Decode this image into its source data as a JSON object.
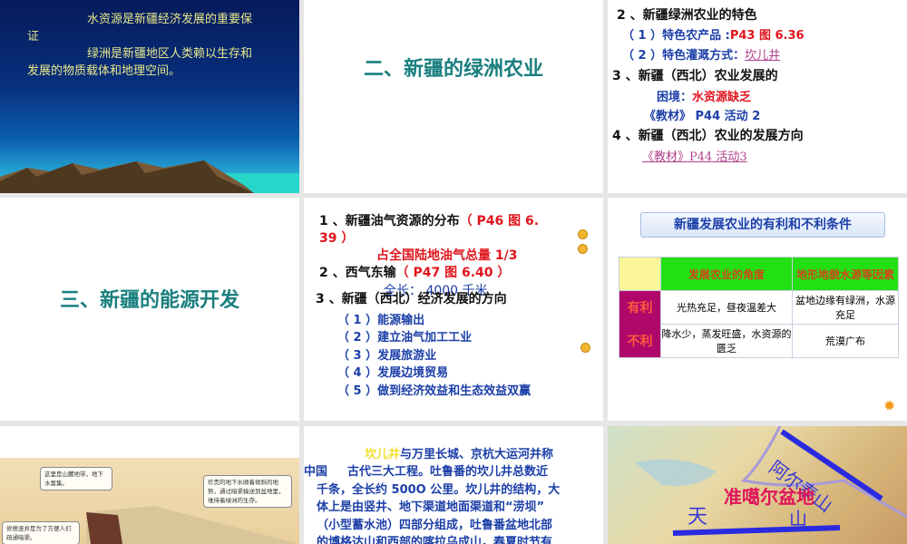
{
  "slide1": {
    "line1": "水资源是新疆经济发展的重要保",
    "line2": "证",
    "line3": "绿洲是新疆地区人类赖以生存和",
    "line4": "发展的物质载体和地理空间。"
  },
  "slide2": {
    "title": "二、新疆的绿洲农业"
  },
  "slide3": {
    "item2": "2 、新疆绿洲农业的特色",
    "sub1_label": "（ 1 ）特色农产品 :",
    "sub1_ref": "P43  图 6.36",
    "sub2_label": "（ 2 ）特色灌溉方式：",
    "sub2_link": "坎儿井",
    "item3": "3 、新疆（西北）农业发展的",
    "dilemma_label": "困境：",
    "dilemma_value": "水资源缺乏",
    "activity2": "《教材》 P44  活动 2",
    "item4": "4 、新疆（西北）农业的发展方向",
    "activity3_link": "《教材》P44  活动3"
  },
  "slide4": {
    "title": "三、新疆的能源开发"
  },
  "slide5": {
    "item1": "1 、新疆油气资源的分布",
    "item1_ref": "（ P46  图 6.",
    "item1_ref2": "39 ）",
    "share": "占全国陆地油气总量 1/3",
    "item2": "2 、西气东输",
    "item2_ref": "（ P47  图 6.40 ）",
    "length": "全长： 4000 千米",
    "item3": "3 、新疆（西北）经济发展的方向",
    "subs": [
      "（ 1 ）能源输出",
      "（ 2 ）建立油气加工工业",
      "（ 3 ）发展旅游业",
      "（ 4 ）发展边境贸易",
      "（ 5 ）做到经济效益和生态效益双赢"
    ]
  },
  "slide6": {
    "banner": "新疆发展农业的有利和不利条件",
    "col1": "发展农业的角度",
    "col2": "地形地貌水源等因素",
    "row1_label": "有利",
    "row1_c1": "光热充足，昼夜温差大",
    "row1_c2": "盆地边缘有绿洲，水源充足",
    "row2_label": "不利",
    "row2_c1": "降水少，蒸发旺盛，水资源的匮乏",
    "row2_c2": "荒漠广布"
  },
  "slide7": {
    "note1": "这里是山麓地带，地下水富集。",
    "note2": "珍贵的地下水顺着倾斜的地势，通过暗渠输送到盆地里，维持着绿洲的生存。",
    "note3": "修凿竖井是为了方便人们疏通暗渠。"
  },
  "slide8": {
    "highlight": "坎儿井",
    "line1": "与万里长城、京杭大运河并称",
    "line2a": "中国",
    "line2b": "古代三大工程。吐鲁番的坎儿井总数近",
    "line3": "千条，全长约 500O 公里。坎儿井的结构，大",
    "line4": "体上是由竖井、地下渠道地面渠道和“涝坝”",
    "line5": "（小型蓄水池）四部分组成，吐鲁番盆地北部",
    "line6": "的博格达山和西部的喀拉乌成山，春夏时节有"
  },
  "slide9": {
    "altai": "阿尔泰山",
    "basin": "准噶尔盆地",
    "tian": "天",
    "shan": "山"
  }
}
